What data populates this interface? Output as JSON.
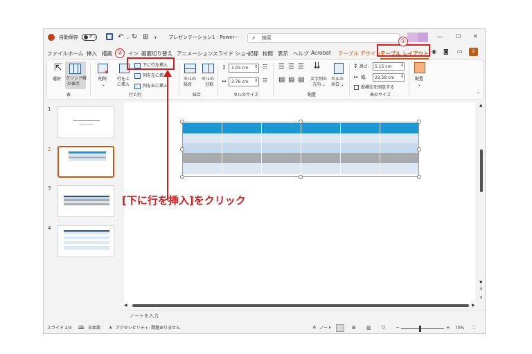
{
  "titlebar": {
    "autosave_label": "自動保存",
    "autosave_state": "オフ",
    "title": "プレゼンテーション1 - Power···",
    "search_placeholder": "検索"
  },
  "tabs": [
    "ファイル",
    "ホーム",
    "挿入",
    "描画",
    "デザイン",
    "画面切り替え",
    "アニメーション",
    "スライド ショー",
    "記録",
    "校閲",
    "表示",
    "ヘルプ",
    "Acrobat",
    "テーブル デザイン",
    "テーブル レイアウト"
  ],
  "tab_visible": {
    "design_partial": "イン"
  },
  "ribbon": {
    "select_label": "選択",
    "gridlines_label": [
      "グリッド線",
      "の表示"
    ],
    "group_table": "表",
    "delete_label": "削除",
    "insert_above_label": [
      "行を上",
      "に挿入"
    ],
    "insert_below": "下に行を挿入",
    "insert_left": "列を左に挿入",
    "insert_right": "列を右に挿入",
    "group_rows_cols": "行と列",
    "merge_cells": [
      "セルの",
      "結合"
    ],
    "split_cells": [
      "セルの",
      "分割"
    ],
    "group_merge": "結合",
    "cell_height": "1.03 cm",
    "cell_width": "3.76 cm",
    "group_cell_size": "セルのサイズ",
    "text_direction": [
      "文字列の",
      "方向 ⌄"
    ],
    "cell_margins": [
      "セルの",
      "余白 ⌄"
    ],
    "group_alignment": "配置",
    "height_label": "高さ:",
    "height_value": "5.15 cm",
    "width_label": "幅:",
    "width_value": "22.58 cm",
    "lock_aspect": "縦横比を固定する",
    "group_table_size": "表のサイズ",
    "arrange_label": "配置"
  },
  "slides": [
    "1",
    "2",
    "3",
    "4"
  ],
  "notes_placeholder": "ノートを入力",
  "status": {
    "slide": "スライド 2/4",
    "language": "日本語",
    "accessibility": "アクセシビリティ: 問題ありません",
    "notes": "ノート",
    "zoom": "70%"
  },
  "annotation": {
    "step1": "①",
    "step2": "②",
    "instruction": "[下に行を挿入]をクリック"
  },
  "colors": {
    "accent_tab": "#c55a11",
    "annotation_red": "#d01e1e",
    "table_header": "#1e96d2",
    "table_band_light": "#dbe7f3",
    "table_band_mid": "#c7d9ec",
    "table_selected_row": "#a9abae"
  }
}
